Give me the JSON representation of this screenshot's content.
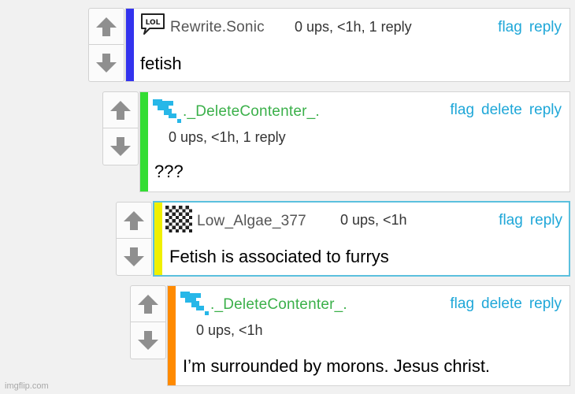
{
  "colors": {
    "link": "#1fa7d8",
    "thread_bar_1": "#3333ee",
    "thread_bar_2": "#33dd33",
    "thread_bar_3": "#f0f000",
    "thread_bar_4": "#ff8a00",
    "highlight_border": "#5bc0de",
    "delete_contenter_name": "#3bb04a"
  },
  "comments": [
    {
      "username": "Rewrite.Sonic",
      "meta": "0 ups, <1h, 1 reply",
      "text": "fetish",
      "icon": "lol-badge-icon",
      "actions": {
        "flag": "flag",
        "reply": "reply"
      }
    },
    {
      "username": "._DeleteContenter_.",
      "meta": "0 ups, <1h, 1 reply",
      "text": "???",
      "icon": "blue-pixel-logo-icon",
      "actions": {
        "flag": "flag",
        "delete": "delete",
        "reply": "reply"
      }
    },
    {
      "username": "Low_Algae_377",
      "meta": "0 ups, <1h",
      "text": "Fetish is associated to furrys",
      "icon": "checkered-avatar-icon",
      "actions": {
        "flag": "flag",
        "reply": "reply"
      }
    },
    {
      "username": "._DeleteContenter_.",
      "meta": "0 ups, <1h",
      "text": "I’m surrounded by morons. Jesus christ.",
      "icon": "blue-pixel-logo-icon",
      "actions": {
        "flag": "flag",
        "delete": "delete",
        "reply": "reply"
      }
    }
  ],
  "watermark": "imgflip.com"
}
